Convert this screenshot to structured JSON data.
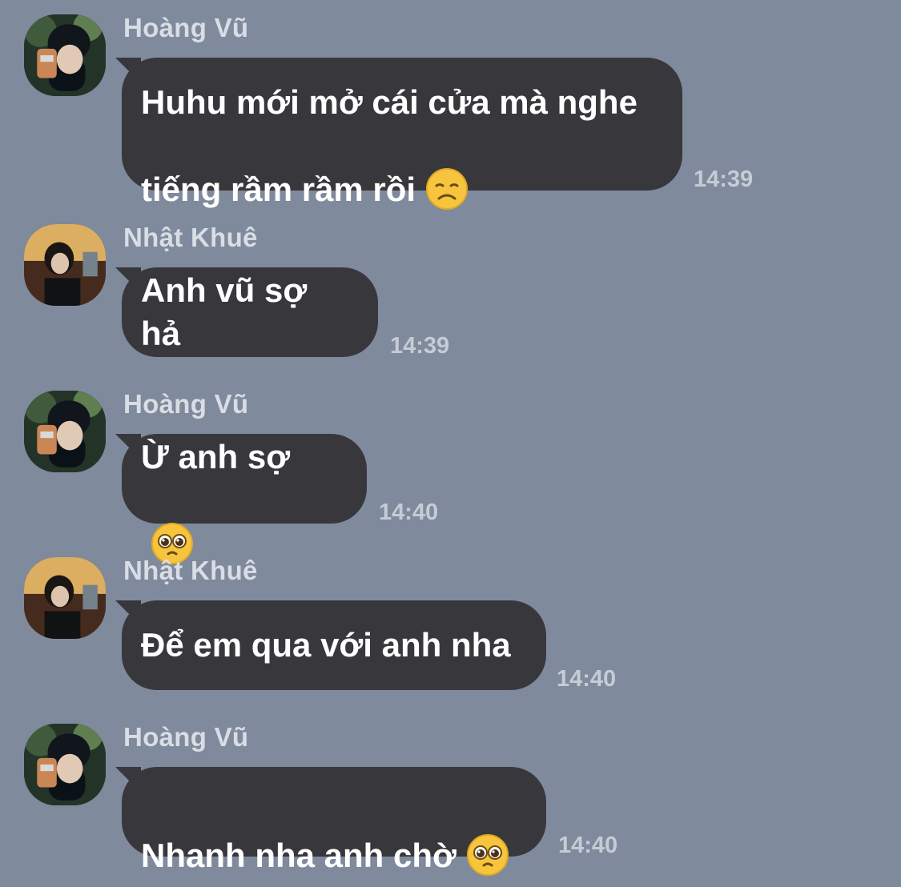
{
  "messages": [
    {
      "sender": "Hoàng Vũ",
      "lines": "Huhu mới mở cái cửa mà nghe\ntiếng rầm rầm rồi",
      "emoji": "disappointed-face-emoji",
      "time": "14:39"
    },
    {
      "sender": "Nhật Khuê",
      "lines": "Anh vũ sợ hả",
      "emoji": "",
      "time": "14:39"
    },
    {
      "sender": "Hoàng Vũ",
      "lines": "Ừ anh sợ",
      "emoji": "pleading-face-emoji",
      "time": "14:40"
    },
    {
      "sender": "Nhật Khuê",
      "lines": "Để em qua với anh nha",
      "emoji": "",
      "time": "14:40"
    },
    {
      "sender": "Hoàng Vũ",
      "lines": "Nhanh nha anh chờ",
      "emoji": "pleading-face-emoji",
      "time": "14:40"
    }
  ],
  "colors": {
    "background": "#7f8a9d",
    "bubble": "#38383c",
    "text": "#ffffff",
    "sender": "#d9dde4",
    "time": "#c5ccd5"
  }
}
